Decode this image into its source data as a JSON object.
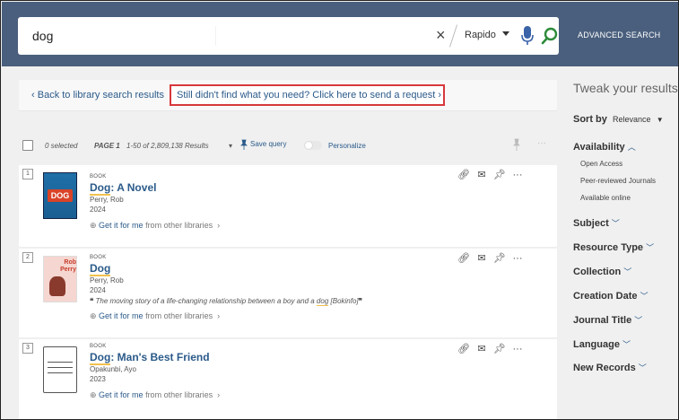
{
  "search": {
    "query": "dog",
    "clear": "×",
    "scope": "Rapido",
    "advanced": "ADVANCED SEARCH"
  },
  "back": {
    "label": "Back to library search results",
    "request": "Still didn't find what you need? Click here to send a request"
  },
  "toolbar": {
    "selected": "0 selected",
    "page": "PAGE 1",
    "range": "1-50 of 2,809,138 Results",
    "save_query": "Save query",
    "personalize": "Personalize",
    "more": "···"
  },
  "records": [
    {
      "num": "1",
      "type": "BOOK",
      "title_hl": "Dog",
      "title_rest": ": A Novel",
      "author": "Perry, Rob",
      "year": "2024",
      "snippet_pre": "",
      "snippet_hl": "",
      "snippet_post": "",
      "getit_label": "Get it for me",
      "getit_rest": " from other libraries",
      "cover": "DOG"
    },
    {
      "num": "2",
      "type": "BOOK",
      "title_hl": "Dog",
      "title_rest": "",
      "author": "Perry, Rob",
      "year": "2024",
      "snippet_pre": "The moving story of a life-changing relationship between a boy and a ",
      "snippet_hl": "dog",
      "snippet_post": " [Bokinfo]",
      "getit_label": "Get it for me",
      "getit_rest": " from other libraries",
      "cover": "Rob Perry"
    },
    {
      "num": "3",
      "type": "BOOK",
      "title_hl": "Dog",
      "title_rest": ": Man's Best Friend",
      "author": "Opakunbi, Ayo",
      "year": "2023",
      "snippet_pre": "",
      "snippet_hl": "",
      "snippet_post": "",
      "getit_label": "Get it for me",
      "getit_rest": " from other libraries",
      "cover": ""
    }
  ],
  "sidebar": {
    "tweak": "Tweak your results",
    "sort_label": "Sort by",
    "sort_value": "Relevance",
    "availability": "Availability",
    "availability_items": [
      "Open Access",
      "Peer-reviewed Journals",
      "Available online"
    ],
    "facets": [
      "Subject",
      "Resource Type",
      "Collection",
      "Creation Date",
      "Journal Title",
      "Language",
      "New Records"
    ]
  },
  "colors": {
    "header": "#4a5f7d",
    "link": "#2a5a8a",
    "highlight": "#f2c14e",
    "request_border": "#d7383c"
  }
}
